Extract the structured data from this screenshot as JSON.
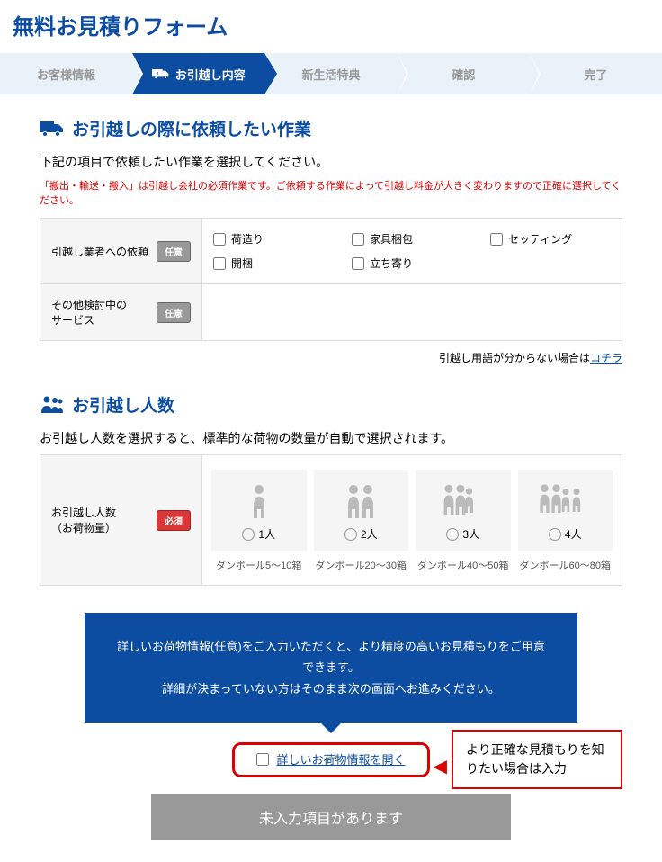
{
  "page_title": "無料お見積りフォーム",
  "progress": {
    "steps": [
      "お客様情報",
      "お引越し内容",
      "新生活特典",
      "確認",
      "完了"
    ],
    "active_index": 1
  },
  "section_tasks": {
    "title": "お引越しの際に依頼したい作業",
    "desc": "下記の項目で依頼したい作業を選択してください。",
    "warning": "「搬出・輸送・搬入」は引越し会社の必須作業です。ご依頼する作業によって引越し料金が大きく変わりますので正確に選択してください。",
    "request_label": "引越し業者への依頼",
    "request_options": [
      "荷造り",
      "家具梱包",
      "セッティング",
      "開梱",
      "立ち寄り"
    ],
    "other_label": "その他検討中の\nサービス"
  },
  "badges": {
    "optional": "任意",
    "required": "必須"
  },
  "help_link": {
    "prefix": "引越し用語が分からない場合は",
    "link": "コチラ"
  },
  "section_people": {
    "title": "お引越し人数",
    "desc": "お引越し人数を選択すると、標準的な荷物の数量が自動で選択されます。",
    "label": "お引越し人数\n（お荷物量）",
    "options": [
      {
        "count": "1人",
        "boxes": "ダンボール5～10箱",
        "persons": 1
      },
      {
        "count": "2人",
        "boxes": "ダンボール20～30箱",
        "persons": 2
      },
      {
        "count": "3人",
        "boxes": "ダンボール40～50箱",
        "persons": 3
      },
      {
        "count": "4人",
        "boxes": "ダンボール60～80箱",
        "persons": 4
      }
    ]
  },
  "callout": {
    "line1": "詳しいお荷物情報(任意)をご入力いただくと、より精度の高いお見積もりをご用意できます。",
    "line2": "詳細が決まっていない方はそのまま次の画面へお進みください。"
  },
  "expand_link": "詳しいお荷物情報を開く",
  "annotation": "より正確な見積もりを知りたい場合は入力",
  "submit_label": "未入力項目があります"
}
